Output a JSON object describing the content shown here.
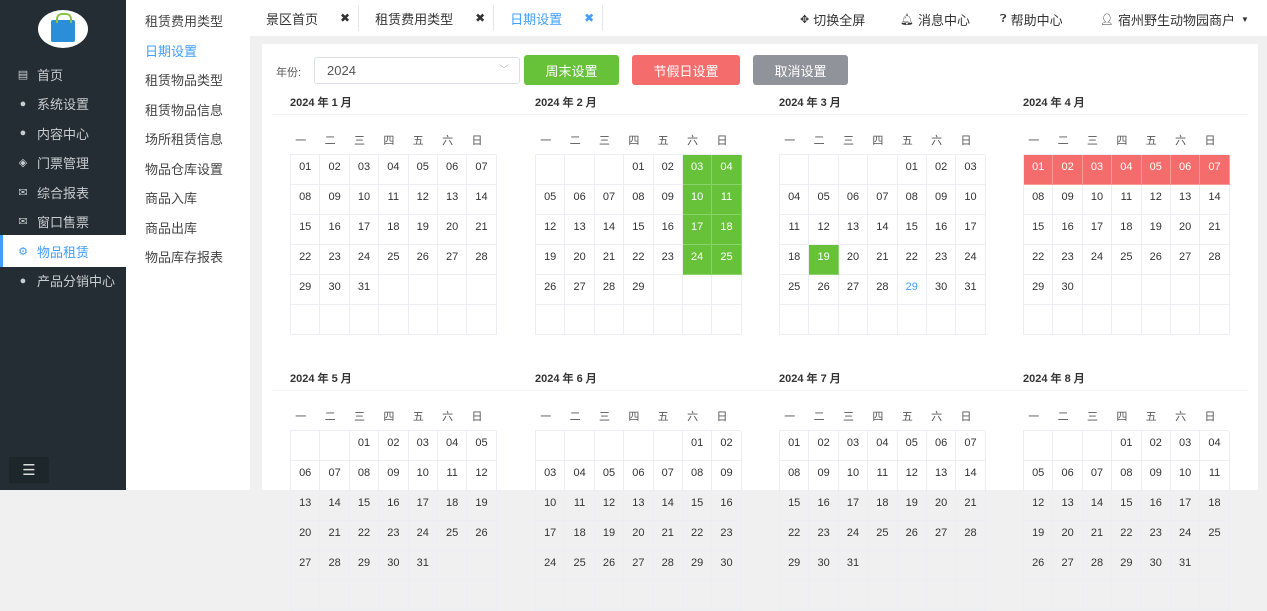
{
  "sidebar": {
    "items": [
      {
        "label": "首页",
        "icon": "home-card-icon"
      },
      {
        "label": "系统设置",
        "icon": "user-icon"
      },
      {
        "label": "内容中心",
        "icon": "user-icon"
      },
      {
        "label": "门票管理",
        "icon": "ticket-icon"
      },
      {
        "label": "综合报表",
        "icon": "envelope-icon"
      },
      {
        "label": "窗口售票",
        "icon": "envelope-icon"
      },
      {
        "label": "物品租赁",
        "icon": "gear-icon",
        "active": true
      },
      {
        "label": "产品分销中心",
        "icon": "user-icon"
      }
    ]
  },
  "submenu": {
    "items": [
      "租赁费用类型",
      "日期设置",
      "租赁物品类型",
      "租赁物品信息",
      "场所租赁信息",
      "物品仓库设置",
      "商品入库",
      "商品出库",
      "物品库存报表"
    ],
    "active": 1
  },
  "tabs": [
    {
      "label": "景区首页"
    },
    {
      "label": "租赁费用类型"
    },
    {
      "label": "日期设置",
      "active": true
    }
  ],
  "topright": {
    "fullscreen": "切换全屏",
    "messages": "消息中心",
    "help": "帮助中心",
    "user": "宿州野生动物园商户"
  },
  "toolbar": {
    "year_label": "年份:",
    "year_value": "2024",
    "weekend_btn": "周末设置",
    "holiday_btn": "节假日设置",
    "cancel_btn": "取消设置"
  },
  "colors": {
    "weekend": "#67c23a",
    "holiday": "#f56c6c",
    "cancel": "#909399",
    "accent": "#409eff"
  },
  "weekdays": [
    "一",
    "二",
    "三",
    "四",
    "五",
    "六",
    "日"
  ],
  "months": [
    {
      "title": "2024 年 1 月",
      "offset": 0,
      "days": 31,
      "green": [],
      "red": []
    },
    {
      "title": "2024 年 2 月",
      "offset": 3,
      "days": 29,
      "green": [
        3,
        4,
        10,
        11,
        17,
        18,
        24,
        25
      ],
      "red": []
    },
    {
      "title": "2024 年 3 月",
      "offset": 4,
      "days": 31,
      "green": [
        19
      ],
      "red": [],
      "today": 29
    },
    {
      "title": "2024 年 4 月",
      "offset": 0,
      "days": 30,
      "green": [],
      "red": [
        1,
        2,
        3,
        4,
        5,
        6,
        7
      ]
    },
    {
      "title": "2024 年 5 月",
      "offset": 2,
      "days": 31,
      "green": [],
      "red": []
    },
    {
      "title": "2024 年 6 月",
      "offset": 5,
      "days": 30,
      "green": [],
      "red": []
    },
    {
      "title": "2024 年 7 月",
      "offset": 0,
      "days": 31,
      "green": [],
      "red": []
    },
    {
      "title": "2024 年 8 月",
      "offset": 3,
      "days": 31,
      "green": [],
      "red": []
    }
  ]
}
